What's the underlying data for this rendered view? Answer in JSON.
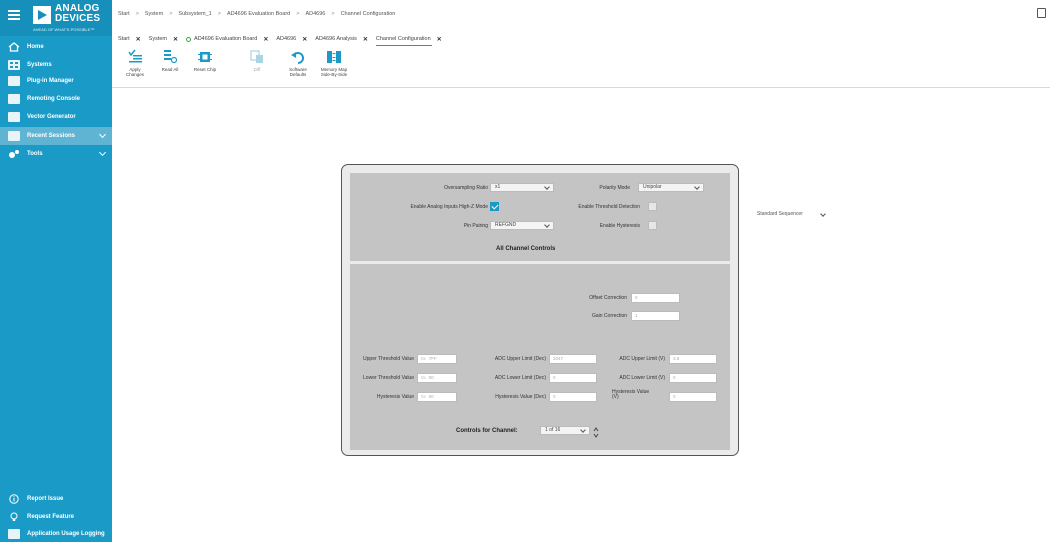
{
  "brand": {
    "logo_line1": "ANALOG",
    "logo_line2": "DEVICES",
    "tagline": "AHEAD OF WHAT'S POSSIBLE™"
  },
  "sidebar": {
    "items": [
      {
        "label": "Home",
        "icon": "home-icon"
      },
      {
        "label": "Systems",
        "icon": "systems-icon"
      },
      {
        "label": "Plug-in Manager",
        "icon": "plugin-icon"
      },
      {
        "label": "Remoting Console",
        "icon": "console-icon"
      },
      {
        "label": "Vector Generator",
        "icon": "vector-icon"
      },
      {
        "label": "Recent Sessions",
        "icon": "sessions-icon"
      },
      {
        "label": "Tools",
        "icon": "tools-icon"
      }
    ],
    "footer": [
      {
        "label": "Report Issue",
        "icon": "info-icon"
      },
      {
        "label": "Request Feature",
        "icon": "lightbulb-icon"
      },
      {
        "label": "Application Usage Logging",
        "icon": "logging-icon"
      }
    ]
  },
  "breadcrumb": [
    "Start",
    "System",
    "Subsystem_1",
    "AD4696 Evaluation Board",
    "AD4696",
    "Channel Configuration"
  ],
  "tabs": [
    {
      "label": "Start"
    },
    {
      "label": "System"
    },
    {
      "label": "AD4696 Evaluation Board"
    },
    {
      "label": "AD4696"
    },
    {
      "label": "AD4696 Analysis"
    },
    {
      "label": "Channel Configuration"
    }
  ],
  "toolbar": {
    "apply_line1": "Apply",
    "apply_line2": "Changes",
    "read_all": "Read All",
    "reset_chip": "Reset Chip",
    "diff": "Diff",
    "software_line1": "Software",
    "software_line2": "Defaults",
    "memory_line1": "Memory Map",
    "memory_line2": "Side-By-Side"
  },
  "sequencer": {
    "value": "Standard Sequencer"
  },
  "top_section": {
    "oversampling_label": "Oversampling Ratio",
    "oversampling_value": "x1",
    "polarity_label": "Polarity Mode",
    "polarity_value": "Unipolar",
    "highz_label": "Enable Analog Inputs High-Z Mode",
    "threshold_label": "Enable Threshold Detection",
    "pin_pairing_label": "Pin Pairing",
    "pin_pairing_value": "REFGND",
    "hysteresis_label": "Enable Hysteresis",
    "all_channel_title": "All Channel Controls"
  },
  "bottom_section": {
    "offset_label": "Offset Correction",
    "offset_value": "0",
    "gain_label": "Gain Correction",
    "gain_value": "1",
    "upper_thresh_label": "Upper Threshold Value",
    "upper_thresh_prefix": "0x",
    "upper_thresh_value": "7FF",
    "lower_thresh_label": "Lower Threshold Value",
    "lower_thresh_prefix": "0x",
    "lower_thresh_value": "00",
    "hyst_label": "Hysteresis Value",
    "hyst_prefix": "0x",
    "hyst_value": "00",
    "adc_upper_dec_label": "ADC Upper Limit (Dec)",
    "adc_upper_dec_value": "2047",
    "adc_lower_dec_label": "ADC Lower Limit (Dec)",
    "adc_lower_dec_value": "0",
    "hyst_dec_label": "Hysteresis Value (Dec)",
    "hyst_dec_value": "0",
    "adc_upper_v_label": "ADC Upper Limit (V)",
    "adc_upper_v_value": "3.6",
    "adc_lower_v_label": "ADC Lower Limit (V)",
    "adc_lower_v_value": "0",
    "hyst_v_label1": "Hysteresis Value",
    "hyst_v_label2": "(V)",
    "hyst_v_value": "0",
    "controls_label": "Controls for Channel:",
    "channel_value": "1 of 16"
  }
}
